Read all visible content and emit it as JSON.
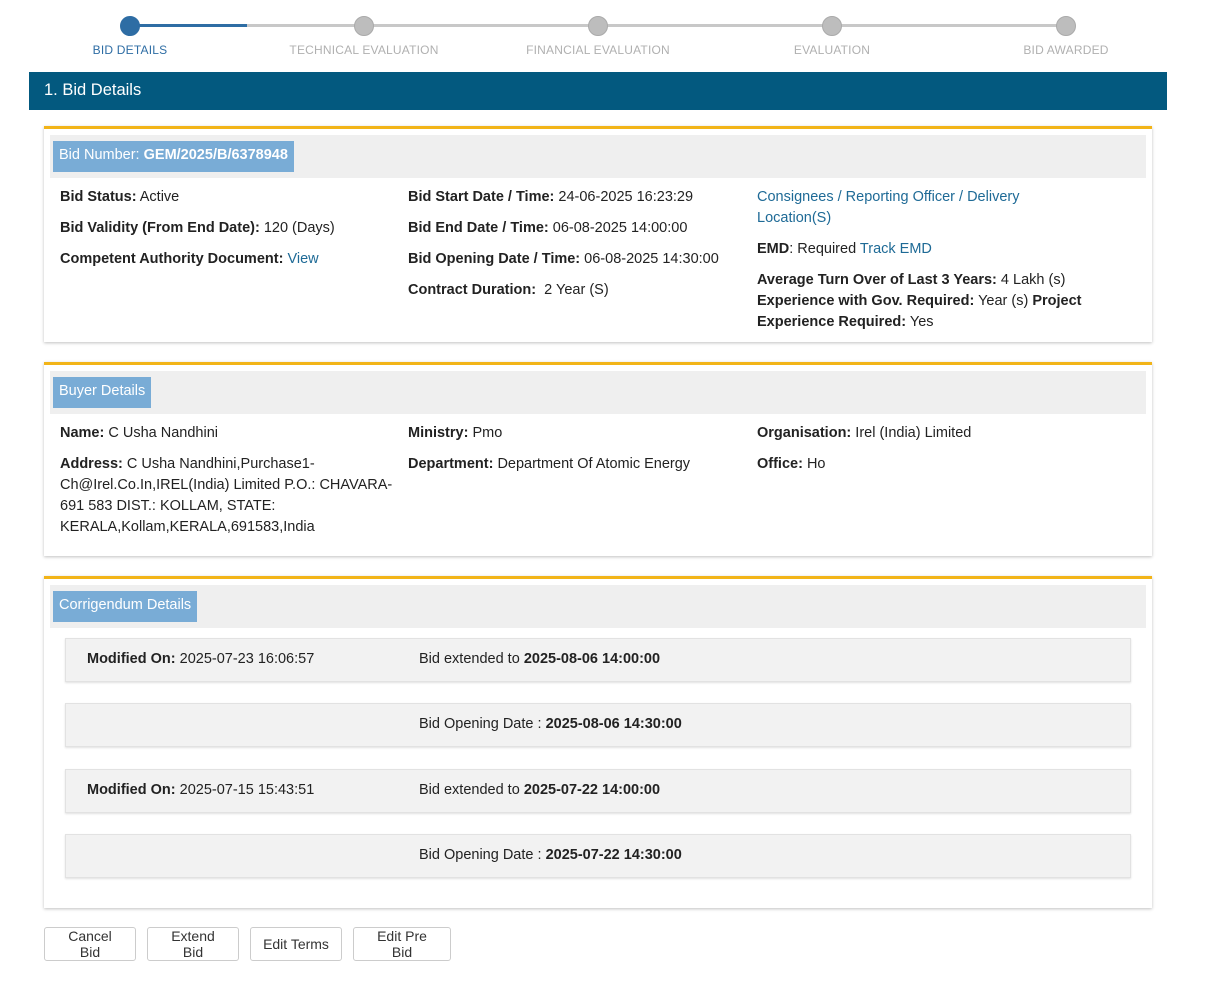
{
  "stepper": {
    "steps": [
      {
        "label": "BID DETAILS",
        "active": true
      },
      {
        "label": "TECHNICAL EVALUATION",
        "active": false
      },
      {
        "label": "FINANCIAL EVALUATION",
        "active": false
      },
      {
        "label": "EVALUATION",
        "active": false
      },
      {
        "label": "BID AWARDED",
        "active": false
      }
    ]
  },
  "section": {
    "title": "1. Bid Details"
  },
  "bid": {
    "number_label": "Bid Number:",
    "number_value": "GEM/2025/B/6378948",
    "status_label": "Bid Status:",
    "status_value": "Active",
    "validity_label": "Bid Validity (From End Date):",
    "validity_value": "120 (Days)",
    "authority_label": "Competent Authority Document:",
    "authority_link": "View",
    "start_label": "Bid Start Date / Time:",
    "start_value": "24-06-2025 16:23:29",
    "end_label": "Bid End Date / Time:",
    "end_value": "06-08-2025 14:00:00",
    "opening_label": "Bid Opening Date / Time:",
    "opening_value": "06-08-2025 14:30:00",
    "duration_label": "Contract Duration:",
    "duration_value": "2 Year (S)",
    "consignees_link_1": "Consignees / Reporting Officer / Delivery",
    "consignees_link_2": "Location(S)",
    "emd_label": "EMD",
    "emd_value": ": Required",
    "emd_link": "Track EMD",
    "turnover_label": "Average Turn Over of Last 3 Years:",
    "turnover_value": "4 Lakh (s)",
    "exp_gov_label": "Experience with Gov. Required:",
    "exp_gov_value": "Year (s)",
    "project_label_1": "Project",
    "project_label_2": "Experience Required:",
    "project_value": "Yes"
  },
  "buyer": {
    "title": "Buyer Details",
    "name_label": "Name:",
    "name_value": "C Usha Nandhini",
    "address_label": "Address:",
    "address_line_1": "C Usha Nandhini,Purchase1-",
    "address_line_2": "Ch@Irel.Co.In,IREL(India) Limited P.O.: CHAVARA-",
    "address_line_3": "691 583 DIST.: KOLLAM, STATE:",
    "address_line_4": "KERALA,Kollam,KERALA,691583,India",
    "ministry_label": "Ministry:",
    "ministry_value": "Pmo",
    "department_label": "Department:",
    "department_value": "Department Of Atomic Energy",
    "org_label": "Organisation:",
    "org_value": "Irel (India) Limited",
    "office_label": "Office:",
    "office_value": "Ho"
  },
  "corrigendum": {
    "title": "Corrigendum Details",
    "rows": [
      {
        "modified_label": "Modified On:",
        "modified_value": "2025-07-23 16:06:57",
        "text": "Bid extended to",
        "value": "2025-08-06 14:00:00"
      },
      {
        "modified_label": "",
        "modified_value": "",
        "text": "Bid Opening Date :",
        "value": "2025-08-06 14:30:00"
      },
      {
        "modified_label": "Modified On:",
        "modified_value": "2025-07-15 15:43:51",
        "text": "Bid extended to",
        "value": "2025-07-22 14:00:00"
      },
      {
        "modified_label": "",
        "modified_value": "",
        "text": "Bid Opening Date :",
        "value": "2025-07-22 14:30:00"
      }
    ]
  },
  "actions": {
    "cancel": "Cancel Bid",
    "extend": "Extend Bid",
    "edit_terms": "Edit Terms",
    "edit_pre_bid": "Edit Pre Bid"
  },
  "colors": {
    "header": "#03597f",
    "accent": "#f2b418",
    "tag": "#79acd6",
    "link": "#1e6a96"
  }
}
